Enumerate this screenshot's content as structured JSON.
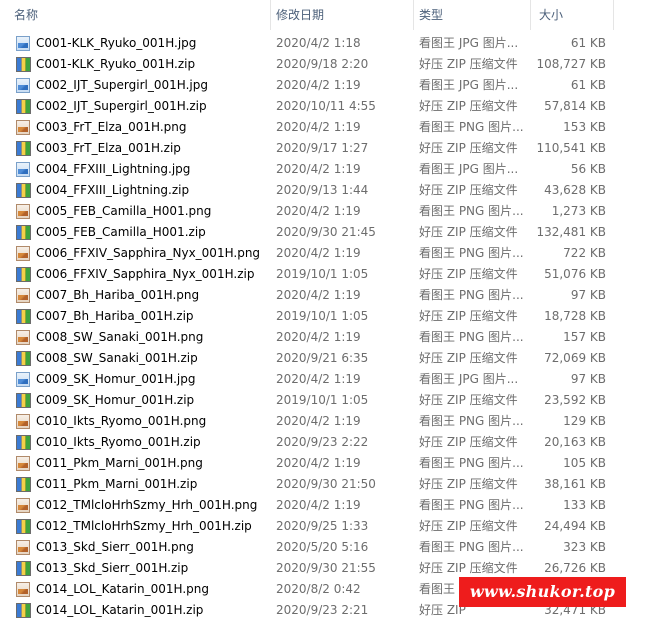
{
  "header": {
    "name": "名称",
    "date": "修改日期",
    "type": "类型",
    "size": "大小"
  },
  "files": [
    {
      "icon": "jpg-file-icon",
      "name": "C001-KLK_Ryuko_001H.jpg",
      "date": "2020/4/2 1:18",
      "type": "看图王 JPG 图片...",
      "size": "61 KB"
    },
    {
      "icon": "zip-archive-icon",
      "name": "C001-KLK_Ryuko_001H.zip",
      "date": "2020/9/18 2:20",
      "type": "好压 ZIP 压缩文件",
      "size": "108,727 KB"
    },
    {
      "icon": "jpg-file-icon",
      "name": "C002_IJT_Supergirl_001H.jpg",
      "date": "2020/4/2 1:19",
      "type": "看图王 JPG 图片...",
      "size": "61 KB"
    },
    {
      "icon": "zip-archive-icon",
      "name": "C002_IJT_Supergirl_001H.zip",
      "date": "2020/10/11 4:55",
      "type": "好压 ZIP 压缩文件",
      "size": "57,814 KB"
    },
    {
      "icon": "png-file-icon",
      "name": "C003_FrT_Elza_001H.png",
      "date": "2020/4/2 1:19",
      "type": "看图王 PNG 图片...",
      "size": "153 KB"
    },
    {
      "icon": "zip-archive-icon",
      "name": "C003_FrT_Elza_001H.zip",
      "date": "2020/9/17 1:27",
      "type": "好压 ZIP 压缩文件",
      "size": "110,541 KB"
    },
    {
      "icon": "jpg-file-icon",
      "name": "C004_FFXIII_Lightning.jpg",
      "date": "2020/4/2 1:19",
      "type": "看图王 JPG 图片...",
      "size": "56 KB"
    },
    {
      "icon": "zip-archive-icon",
      "name": "C004_FFXIII_Lightning.zip",
      "date": "2020/9/13 1:44",
      "type": "好压 ZIP 压缩文件",
      "size": "43,628 KB"
    },
    {
      "icon": "png-file-icon",
      "name": "C005_FEB_Camilla_H001.png",
      "date": "2020/4/2 1:19",
      "type": "看图王 PNG 图片...",
      "size": "1,273 KB"
    },
    {
      "icon": "zip-archive-icon",
      "name": "C005_FEB_Camilla_H001.zip",
      "date": "2020/9/30 21:45",
      "type": "好压 ZIP 压缩文件",
      "size": "132,481 KB"
    },
    {
      "icon": "png-file-icon",
      "name": "C006_FFXIV_Sapphira_Nyx_001H.png",
      "date": "2020/4/2 1:19",
      "type": "看图王 PNG 图片...",
      "size": "722 KB"
    },
    {
      "icon": "zip-archive-icon",
      "name": "C006_FFXIV_Sapphira_Nyx_001H.zip",
      "date": "2019/10/1 1:05",
      "type": "好压 ZIP 压缩文件",
      "size": "51,076 KB"
    },
    {
      "icon": "png-file-icon",
      "name": "C007_Bh_Hariba_001H.png",
      "date": "2020/4/2 1:19",
      "type": "看图王 PNG 图片...",
      "size": "97 KB"
    },
    {
      "icon": "zip-archive-icon",
      "name": "C007_Bh_Hariba_001H.zip",
      "date": "2019/10/1 1:05",
      "type": "好压 ZIP 压缩文件",
      "size": "18,728 KB"
    },
    {
      "icon": "png-file-icon",
      "name": "C008_SW_Sanaki_001H.png",
      "date": "2020/4/2 1:19",
      "type": "看图王 PNG 图片...",
      "size": "157 KB"
    },
    {
      "icon": "zip-archive-icon",
      "name": "C008_SW_Sanaki_001H.zip",
      "date": "2020/9/21 6:35",
      "type": "好压 ZIP 压缩文件",
      "size": "72,069 KB"
    },
    {
      "icon": "jpg-file-icon",
      "name": "C009_SK_Homur_001H.jpg",
      "date": "2020/4/2 1:19",
      "type": "看图王 JPG 图片...",
      "size": "97 KB"
    },
    {
      "icon": "zip-archive-icon",
      "name": "C009_SK_Homur_001H.zip",
      "date": "2019/10/1 1:05",
      "type": "好压 ZIP 压缩文件",
      "size": "23,592 KB"
    },
    {
      "icon": "png-file-icon",
      "name": "C010_Ikts_Ryomo_001H.png",
      "date": "2020/4/2 1:19",
      "type": "看图王 PNG 图片...",
      "size": "129 KB"
    },
    {
      "icon": "zip-archive-icon",
      "name": "C010_Ikts_Ryomo_001H.zip",
      "date": "2020/9/23 2:22",
      "type": "好压 ZIP 压缩文件",
      "size": "20,163 KB"
    },
    {
      "icon": "png-file-icon",
      "name": "C011_Pkm_Marni_001H.png",
      "date": "2020/4/2 1:19",
      "type": "看图王 PNG 图片...",
      "size": "105 KB"
    },
    {
      "icon": "zip-archive-icon",
      "name": "C011_Pkm_Marni_001H.zip",
      "date": "2020/9/30 21:50",
      "type": "好压 ZIP 压缩文件",
      "size": "38,161 KB"
    },
    {
      "icon": "png-file-icon",
      "name": "C012_TMlcloHrhSzmy_Hrh_001H.png",
      "date": "2020/4/2 1:19",
      "type": "看图王 PNG 图片...",
      "size": "133 KB"
    },
    {
      "icon": "zip-archive-icon",
      "name": "C012_TMlcloHrhSzmy_Hrh_001H.zip",
      "date": "2020/9/25 1:33",
      "type": "好压 ZIP 压缩文件",
      "size": "24,494 KB"
    },
    {
      "icon": "png-file-icon",
      "name": "C013_Skd_Sierr_001H.png",
      "date": "2020/5/20 5:16",
      "type": "看图王 PNG 图片...",
      "size": "323 KB"
    },
    {
      "icon": "zip-archive-icon",
      "name": "C013_Skd_Sierr_001H.zip",
      "date": "2020/9/30 21:55",
      "type": "好压 ZIP 压缩文件",
      "size": "26,726 KB"
    },
    {
      "icon": "png-file-icon",
      "name": "C014_LOL_Katarin_001H.png",
      "date": "2020/8/2 0:42",
      "type": "看图王",
      "size": ""
    },
    {
      "icon": "zip-archive-icon",
      "name": "C014_LOL_Katarin_001H.zip",
      "date": "2020/9/23 2:21",
      "type": "好压 ZIP",
      "size": "32,471 KB"
    }
  ],
  "watermark": "www.shukor.top"
}
